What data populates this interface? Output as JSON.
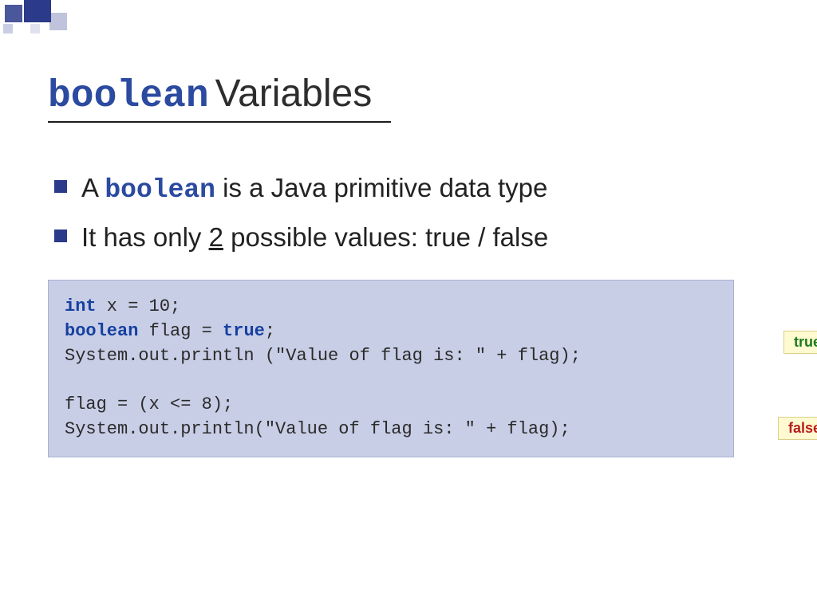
{
  "title": {
    "code": "boolean",
    "rest": " Variables"
  },
  "bullets": [
    {
      "pre": "A ",
      "code": "boolean",
      "post": " is a Java primitive data type"
    },
    {
      "pre": "It has only ",
      "u": "2",
      "post": " possible values: true / false"
    }
  ],
  "code": {
    "l1a": "int",
    "l1b": " x = 10;",
    "l2a": "boolean",
    "l2b": " flag = ",
    "l2c": "true",
    "l2d": ";",
    "l3": "System.out.println (\"Value of flag is: \" + flag);",
    "blank": "",
    "l4": "flag = (x <= 8);",
    "l5": "System.out.println(\"Value of flag is: \" + flag);"
  },
  "tags": {
    "true": "true",
    "false": "false"
  }
}
